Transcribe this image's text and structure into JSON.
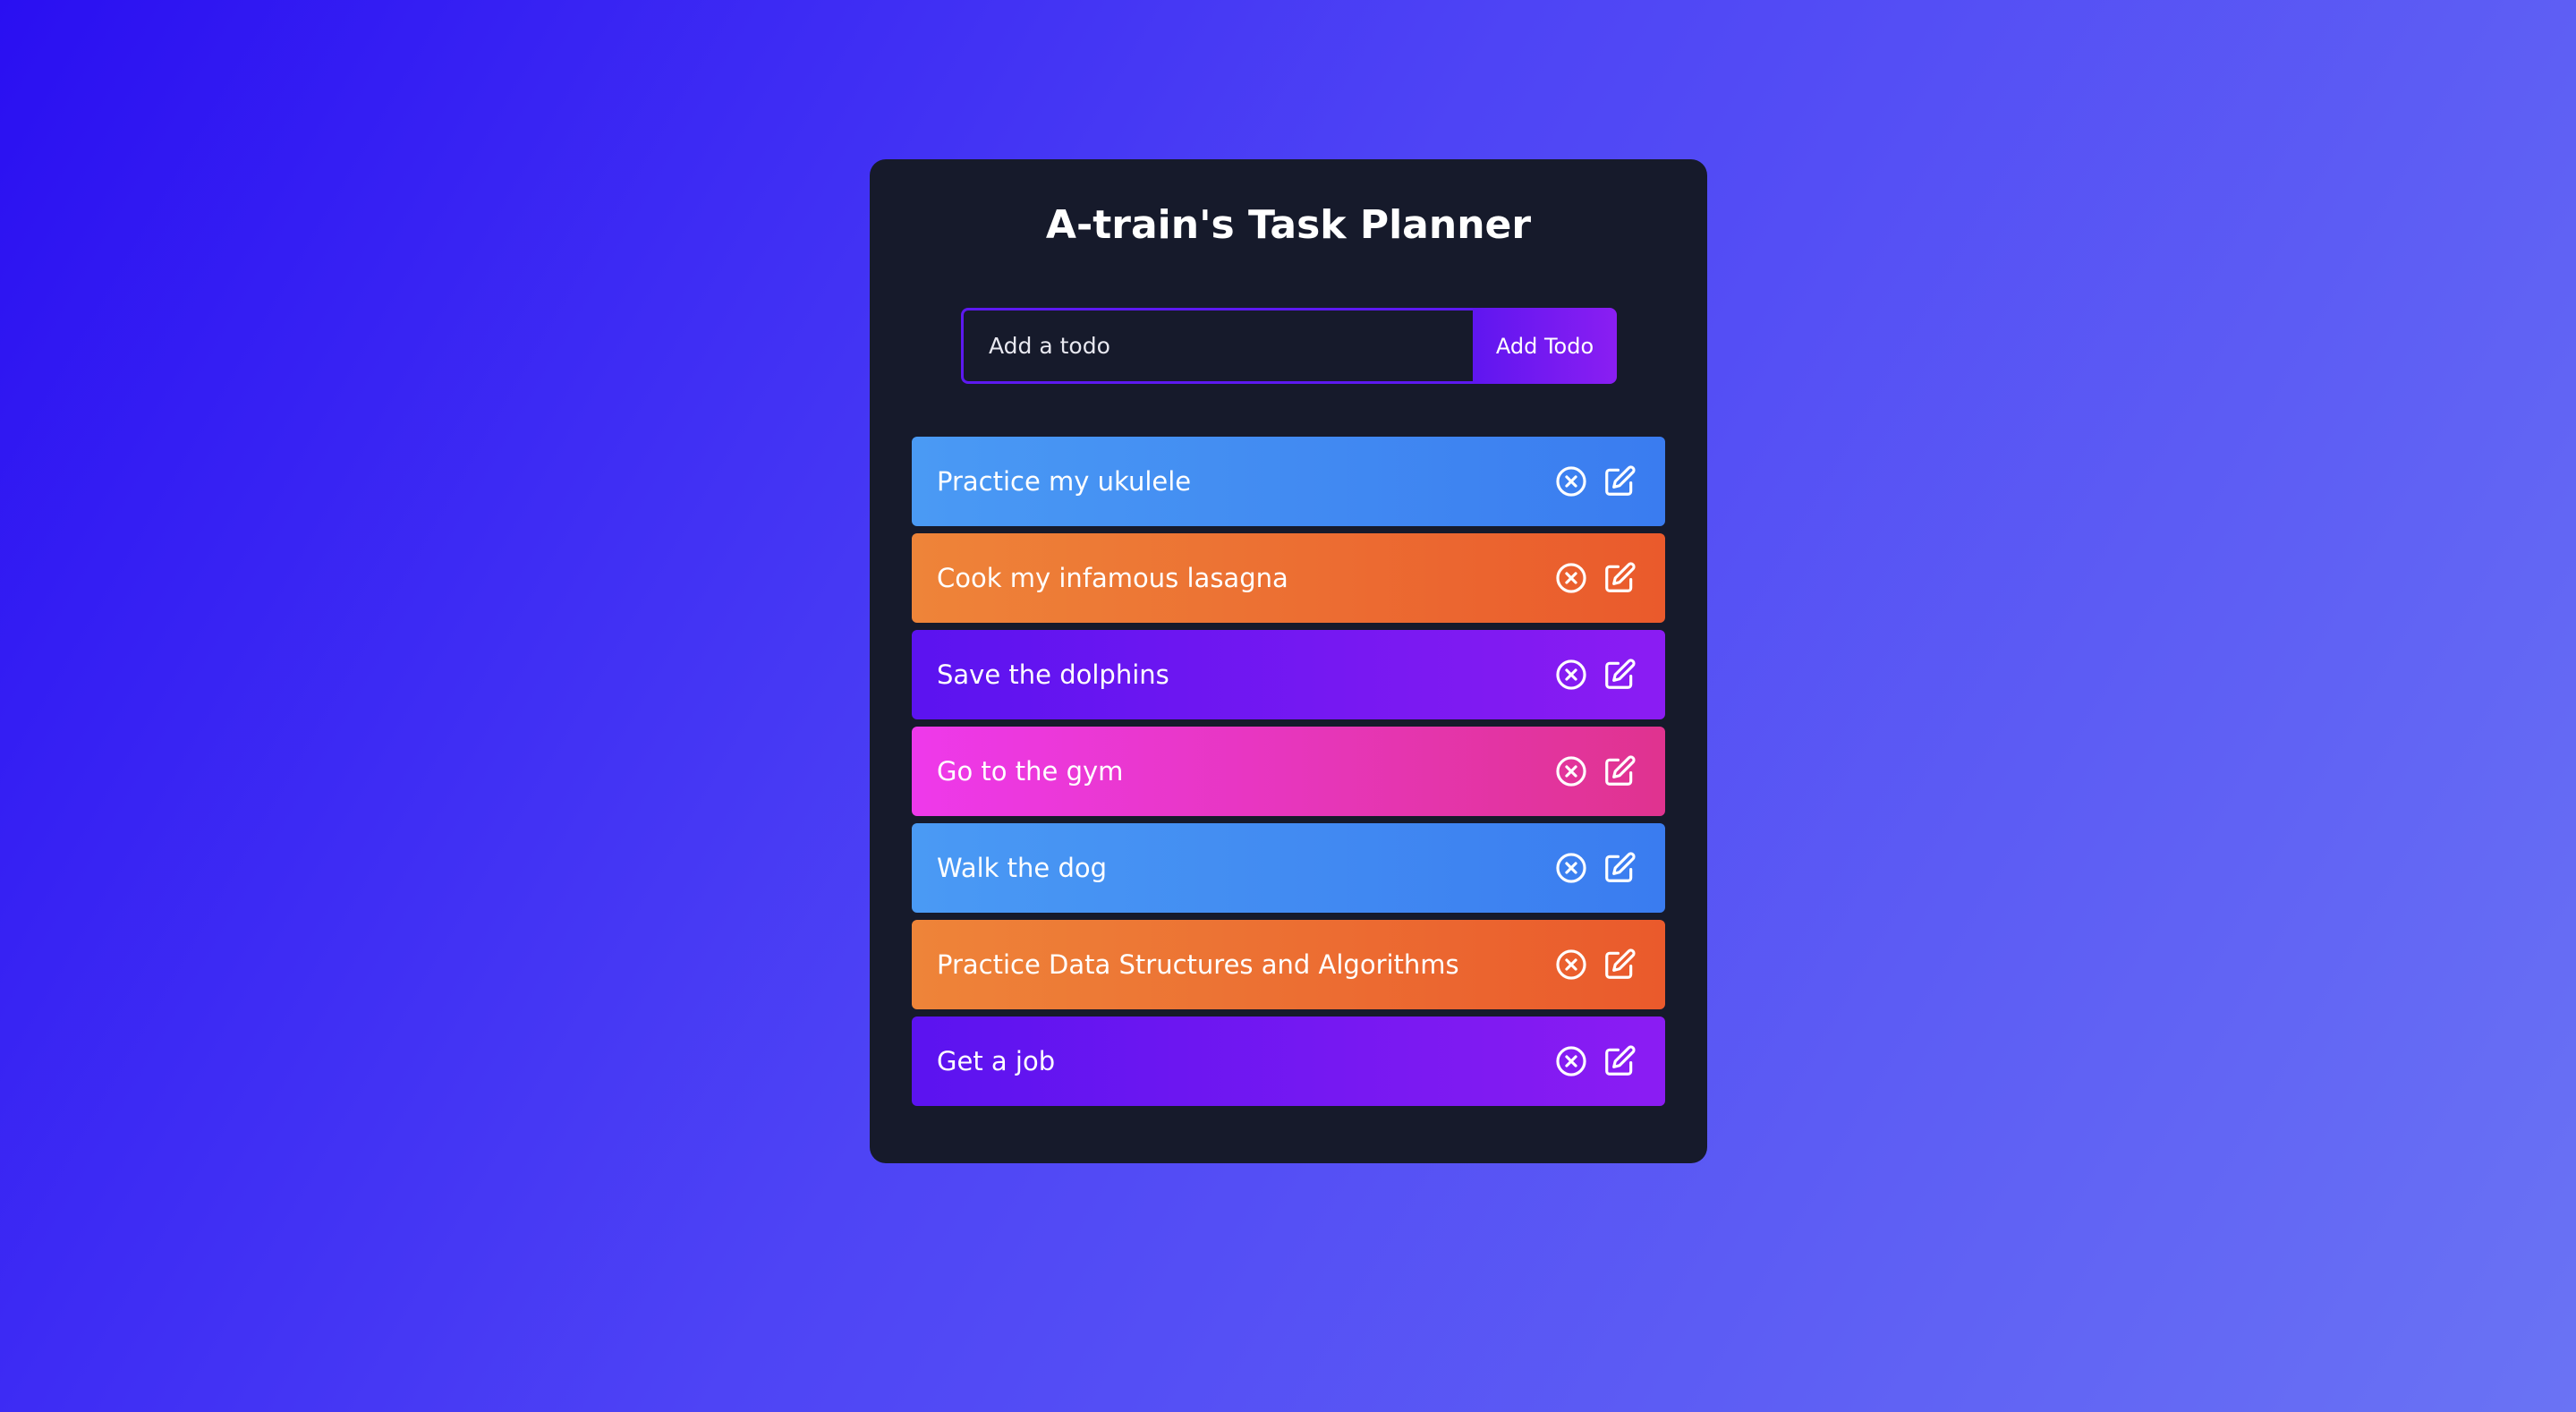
{
  "app": {
    "title": "A-train's Task Planner"
  },
  "form": {
    "input_placeholder": "Add a todo",
    "input_value": "",
    "add_button_label": "Add Todo"
  },
  "todos": [
    {
      "text": "Practice my ukulele",
      "color": "#3f8af2"
    },
    {
      "text": "Cook my infamous lasagna",
      "color": "#ec6f33"
    },
    {
      "text": "Save the dolphins",
      "color": "#7418f1"
    },
    {
      "text": "Go to the gym",
      "color": "#e736bd"
    },
    {
      "text": "Walk the dog",
      "color": "#3f8af2"
    },
    {
      "text": "Practice Data Structures and Algorithms",
      "color": "#ec6f33"
    },
    {
      "text": "Get a job",
      "color": "#7418f1"
    }
  ],
  "icons": {
    "delete": "close-circle-icon",
    "edit": "edit-icon"
  },
  "colors": {
    "panel": "#161a2b",
    "accent": "#5f16f0",
    "blue": "#3f8af2",
    "orange": "#ec6f33",
    "purple": "#7418f1",
    "pink": "#e736bd"
  }
}
